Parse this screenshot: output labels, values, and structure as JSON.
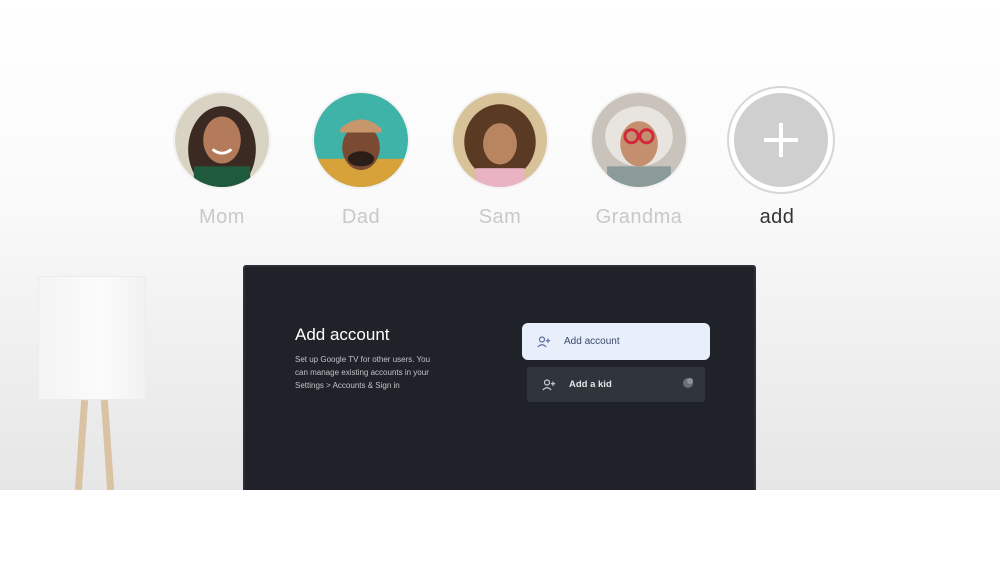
{
  "profiles": [
    {
      "name": "Mom",
      "avatar": "mom-avatar"
    },
    {
      "name": "Dad",
      "avatar": "dad-avatar"
    },
    {
      "name": "Sam",
      "avatar": "sam-avatar"
    },
    {
      "name": "Grandma",
      "avatar": "grandma-avatar"
    }
  ],
  "add_profile": {
    "label": "add",
    "icon": "plus-icon"
  },
  "tv": {
    "title": "Add account",
    "description": "Set up Google TV for other users. You can manage existing accounts in your Settings > Accounts & Sign in",
    "options": [
      {
        "label": "Add account",
        "icon": "person-add-icon"
      },
      {
        "label": "Add a kid",
        "icon": "person-add-icon"
      }
    ]
  },
  "colors": {
    "tv_screen": "#1f2329",
    "selected_option": "#e9eefb",
    "profile_label": "#c9c9c9",
    "add_label": "#333333"
  }
}
